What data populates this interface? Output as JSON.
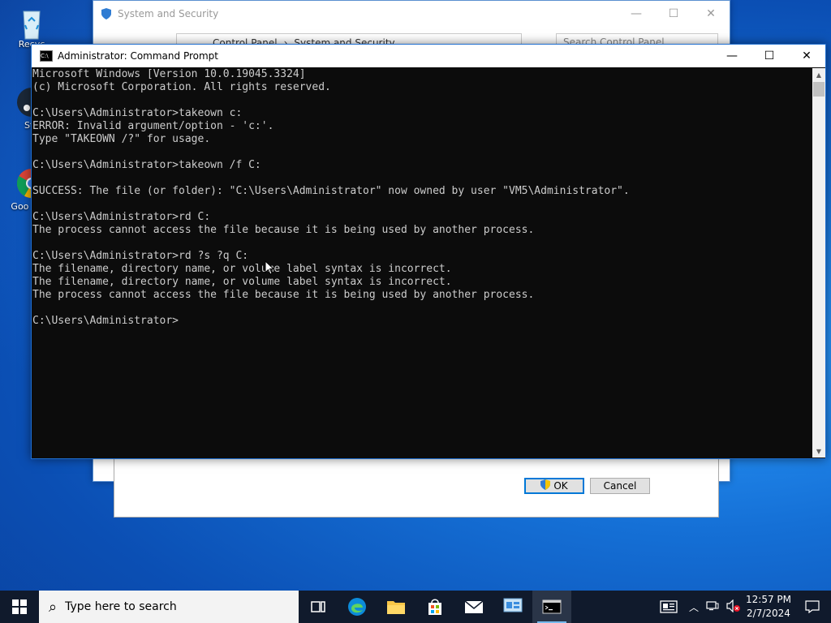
{
  "desktop": {
    "icons": [
      {
        "label": "Recyc",
        "name": "recycle-bin-icon"
      },
      {
        "label": "Ste",
        "name": "steam-icon"
      },
      {
        "label": "Goo Chro",
        "name": "google-chrome-icon"
      }
    ]
  },
  "background_window": {
    "title": "System and Security",
    "breadcrumb": [
      "Control Panel",
      "System and Security"
    ],
    "search_placeholder": "Search Control Panel",
    "ok_label": "OK",
    "cancel_label": "Cancel"
  },
  "cmd_window": {
    "title": "Administrator: Command Prompt",
    "lines": [
      "Microsoft Windows [Version 10.0.19045.3324]",
      "(c) Microsoft Corporation. All rights reserved.",
      "",
      "C:\\Users\\Administrator>takeown c:",
      "ERROR: Invalid argument/option - 'c:'.",
      "Type \"TAKEOWN /?\" for usage.",
      "",
      "C:\\Users\\Administrator>takeown /f C:",
      "",
      "SUCCESS: The file (or folder): \"C:\\Users\\Administrator\" now owned by user \"VM5\\Administrator\".",
      "",
      "C:\\Users\\Administrator>rd C:",
      "The process cannot access the file because it is being used by another process.",
      "",
      "C:\\Users\\Administrator>rd ?s ?q C:",
      "The filename, directory name, or volume label syntax is incorrect.",
      "The filename, directory name, or volume label syntax is incorrect.",
      "The process cannot access the file because it is being used by another process.",
      "",
      "C:\\Users\\Administrator>"
    ]
  },
  "taskbar": {
    "search_placeholder": "Type here to search",
    "apps": [
      {
        "name": "task-view-icon"
      },
      {
        "name": "edge-icon"
      },
      {
        "name": "file-explorer-icon"
      },
      {
        "name": "microsoft-store-icon"
      },
      {
        "name": "mail-icon"
      },
      {
        "name": "control-panel-icon"
      },
      {
        "name": "command-prompt-icon",
        "active": true
      }
    ],
    "time": "12:57 PM",
    "date": "2/7/2024"
  },
  "colors": {
    "cmd_bg": "#0c0c0c",
    "cmd_text": "#cccccc",
    "taskbar_bg": "#101a2c",
    "accent": "#0078d7"
  }
}
